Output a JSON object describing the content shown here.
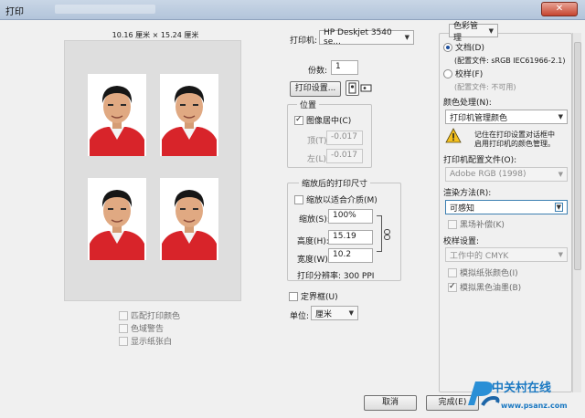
{
  "window": {
    "title": "打印"
  },
  "preview": {
    "dimensions": "10.16 厘米 × 15.24 厘米",
    "options": [
      {
        "label": "匹配打印颜色"
      },
      {
        "label": "色域警告"
      },
      {
        "label": "显示纸张白"
      }
    ]
  },
  "printer": {
    "label": "打印机:",
    "value": "HP Deskjet 3540 se...",
    "copies_label": "份数:",
    "copies_value": "1",
    "setup_button": "打印设置..."
  },
  "position": {
    "legend": "位置",
    "center_label": "图像居中(C)",
    "top_label": "顶(T):",
    "top_value": "-0.017",
    "left_label": "左(L):",
    "left_value": "-0.017"
  },
  "scaled": {
    "legend": "缩放后的打印尺寸",
    "fit_label": "缩放以适合介质(M)",
    "scale_label": "缩放(S):",
    "scale_value": "100%",
    "height_label": "高度(H):",
    "height_value": "15.19",
    "width_label": "宽度(W):",
    "width_value": "10.2",
    "resolution": "打印分辨率: 300 PPI"
  },
  "bounding_box": {
    "label": "定界框(U)"
  },
  "units": {
    "label": "单位:",
    "value": "厘米"
  },
  "color_mgmt": {
    "dropdown": "色彩管理",
    "document_label": "文档(D)",
    "document_profile": "(配置文件: sRGB IEC61966-2.1)",
    "proof_label": "校样(F)",
    "proof_profile": "(配置文件: 不可用)",
    "handling_label": "颜色处理(N):",
    "handling_value": "打印机管理颜色",
    "warning_line1": "记住在打印设置对话框中",
    "warning_line2": "启用打印机的颜色管理。",
    "printer_profile_label": "打印机配置文件(O):",
    "printer_profile_value": "Adobe RGB (1998)",
    "intent_label": "渲染方法(R):",
    "intent_value": "可感知",
    "bpc_label": "黑场补偿(K)",
    "proof_setup_label": "校样设置:",
    "proof_setup_value": "工作中的 CMYK",
    "sim_paper_label": "模拟纸张颜色(I)",
    "sim_black_label": "模拟黑色油墨(B)"
  },
  "footer": {
    "cancel": "取消",
    "done": "完成(E)"
  },
  "watermark": {
    "line1": "中关村在线",
    "line2": "www.psanz.com"
  },
  "colors": {
    "accent": "#1d4e9c",
    "canvas": "#dedede",
    "title_bar": "#b2c4da"
  }
}
